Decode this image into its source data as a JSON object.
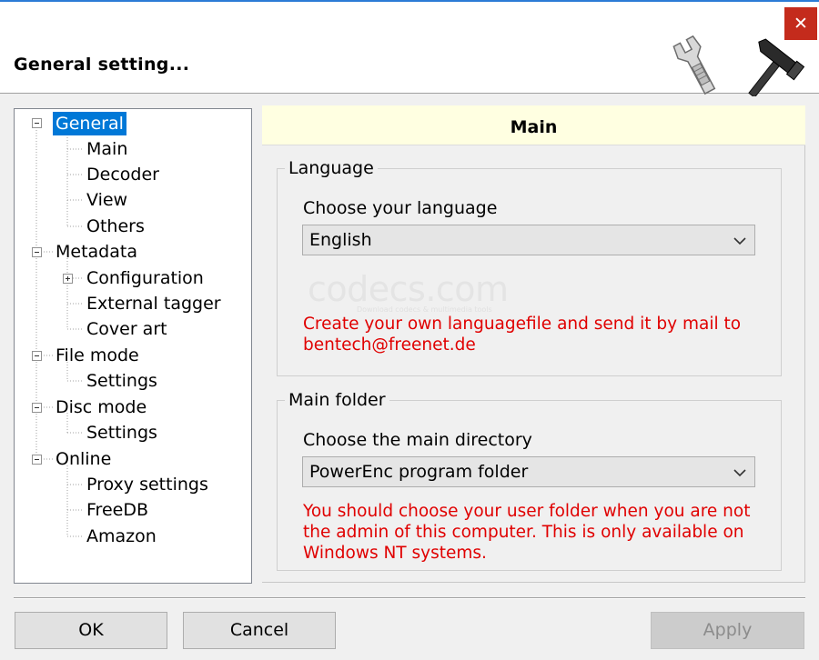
{
  "window": {
    "title": "General setting...",
    "close_glyph": "✕"
  },
  "tree": {
    "items": [
      {
        "label": "General",
        "level": 0,
        "expander": "minus",
        "selected": true
      },
      {
        "label": "Main",
        "level": 1
      },
      {
        "label": "Decoder",
        "level": 1
      },
      {
        "label": "View",
        "level": 1
      },
      {
        "label": "Others",
        "level": 1
      },
      {
        "label": "Metadata",
        "level": 0,
        "expander": "minus"
      },
      {
        "label": "Configuration",
        "level": 1,
        "expander": "plus"
      },
      {
        "label": "External tagger",
        "level": 1
      },
      {
        "label": "Cover art",
        "level": 1
      },
      {
        "label": "File mode",
        "level": 0,
        "expander": "minus"
      },
      {
        "label": "Settings",
        "level": 1
      },
      {
        "label": "Disc mode",
        "level": 0,
        "expander": "minus"
      },
      {
        "label": "Settings",
        "level": 1
      },
      {
        "label": "Online",
        "level": 0,
        "expander": "minus"
      },
      {
        "label": "Proxy settings",
        "level": 1
      },
      {
        "label": "FreeDB",
        "level": 1
      },
      {
        "label": "Amazon",
        "level": 1
      }
    ]
  },
  "panel": {
    "title": "Main",
    "language": {
      "group_title": "Language",
      "label": "Choose your language",
      "selected": "English",
      "note": "Create your own languagefile and send it by mail to bentech@freenet.de"
    },
    "main_folder": {
      "group_title": "Main folder",
      "label": "Choose the main directory",
      "selected": "PowerEnc program folder",
      "note": "You should choose your user folder when you are not the admin of this computer. This is only available on Windows NT systems."
    }
  },
  "watermark": {
    "text": "codecs.com",
    "subtext": "Download codecs & multimedia tools"
  },
  "buttons": {
    "ok": "OK",
    "cancel": "Cancel",
    "apply": "Apply"
  },
  "colors": {
    "accent": "#0078d7",
    "warning": "#e00000",
    "close": "#c42b1c",
    "panel_header": "#ffffe1"
  },
  "icons": {
    "logo": "wrench-hammer-icon",
    "dropdown": "chevron-down-icon",
    "expand": "minus-box-icon",
    "collapse": "plus-box-icon"
  }
}
